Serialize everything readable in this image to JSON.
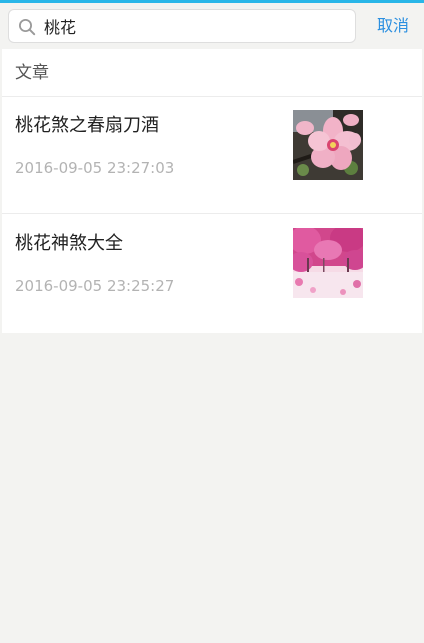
{
  "search": {
    "query": "桃花",
    "cancel_label": "取消"
  },
  "results": {
    "section_title": "文章",
    "items": [
      {
        "title": "桃花煞之春扇刀酒",
        "date": "2016-09-05 23:27:03",
        "thumbnail": "peach-blossom-closeup-image"
      },
      {
        "title": "桃花神煞大全",
        "date": "2016-09-05 23:25:27",
        "thumbnail": "peach-blossom-trees-image"
      }
    ]
  },
  "colors": {
    "accent": "#2b8fe0",
    "top_bar": "#29b6e8",
    "background": "#f3f3f1",
    "date_text": "#b3b3b3"
  }
}
